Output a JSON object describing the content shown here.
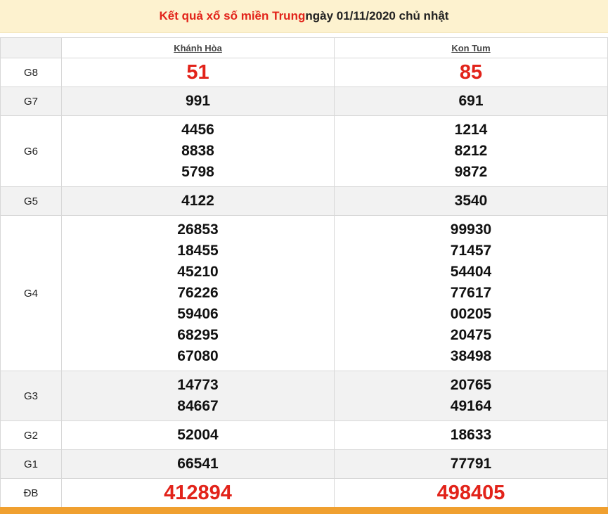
{
  "header": {
    "title_part1": "Kết quả xổ số miền Trung",
    "title_part2": " ngày 01/11/2020 chủ nhật"
  },
  "provinces": [
    "Khánh Hòa",
    "Kon Tum"
  ],
  "rows": {
    "g8": {
      "label": "G8",
      "values": [
        [
          "51"
        ],
        [
          "85"
        ]
      ]
    },
    "g7": {
      "label": "G7",
      "values": [
        [
          "991"
        ],
        [
          "691"
        ]
      ]
    },
    "g6": {
      "label": "G6",
      "values": [
        [
          "4456",
          "8838",
          "5798"
        ],
        [
          "1214",
          "8212",
          "9872"
        ]
      ]
    },
    "g5": {
      "label": "G5",
      "values": [
        [
          "4122"
        ],
        [
          "3540"
        ]
      ]
    },
    "g4": {
      "label": "G4",
      "values": [
        [
          "26853",
          "18455",
          "45210",
          "76226",
          "59406",
          "68295",
          "67080"
        ],
        [
          "99930",
          "71457",
          "54404",
          "77617",
          "00205",
          "20475",
          "38498"
        ]
      ]
    },
    "g3": {
      "label": "G3",
      "values": [
        [
          "14773",
          "84667"
        ],
        [
          "20765",
          "49164"
        ]
      ]
    },
    "g2": {
      "label": "G2",
      "values": [
        [
          "52004"
        ],
        [
          "18633"
        ]
      ]
    },
    "g1": {
      "label": "G1",
      "values": [
        [
          "66541"
        ],
        [
          "77791"
        ]
      ]
    },
    "db": {
      "label": "ĐB",
      "values": [
        [
          "412894"
        ],
        [
          "498405"
        ]
      ]
    }
  },
  "colors": {
    "accent_red": "#e2231a",
    "header_bg": "#fdf2cf",
    "bottom_strip": "#f0a030"
  }
}
